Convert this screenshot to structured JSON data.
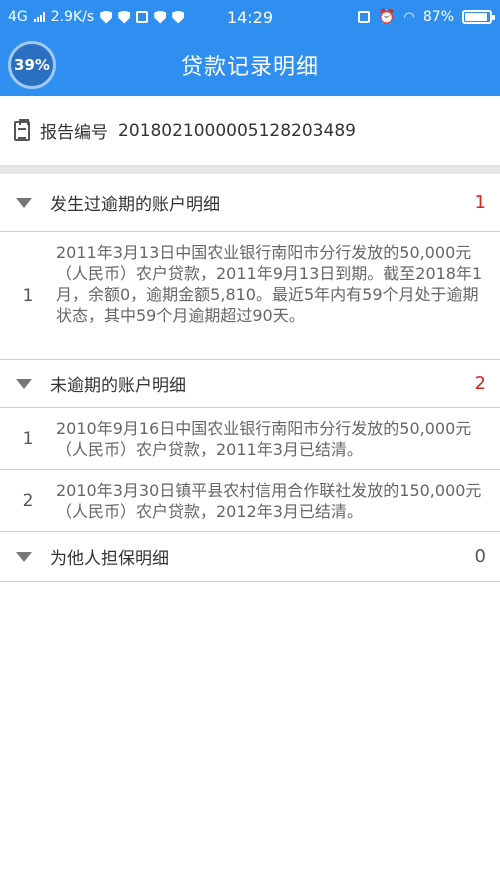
{
  "status": {
    "network": "4G",
    "speed": "2.9K/s",
    "time": "14:29",
    "battery": "87%"
  },
  "header": {
    "title": "贷款记录明细",
    "progress": "39%"
  },
  "report": {
    "label": "报告编号",
    "number": "2018021000005128203489"
  },
  "sections": [
    {
      "title": "发生过逾期的账户明细",
      "count": "1",
      "records": [
        {
          "index": "1",
          "text": "2011年3月13日中国农业银行南阳市分行发放的50,000元（人民币）农户贷款，2011年9月13日到期。截至2018年1月，余额0，逾期金额5,810。最近5年内有59个月处于逾期状态，其中59个月逾期超过90天。"
        }
      ]
    },
    {
      "title": "未逾期的账户明细",
      "count": "2",
      "records": [
        {
          "index": "1",
          "text": "2010年9月16日中国农业银行南阳市分行发放的50,000元（人民币）农户贷款，2011年3月已结清。"
        },
        {
          "index": "2",
          "text": "2010年3月30日镇平县农村信用合作联社发放的150,000元（人民币）农户贷款，2012年3月已结清。"
        }
      ]
    },
    {
      "title": "为他人担保明细",
      "count": "0",
      "records": []
    }
  ]
}
